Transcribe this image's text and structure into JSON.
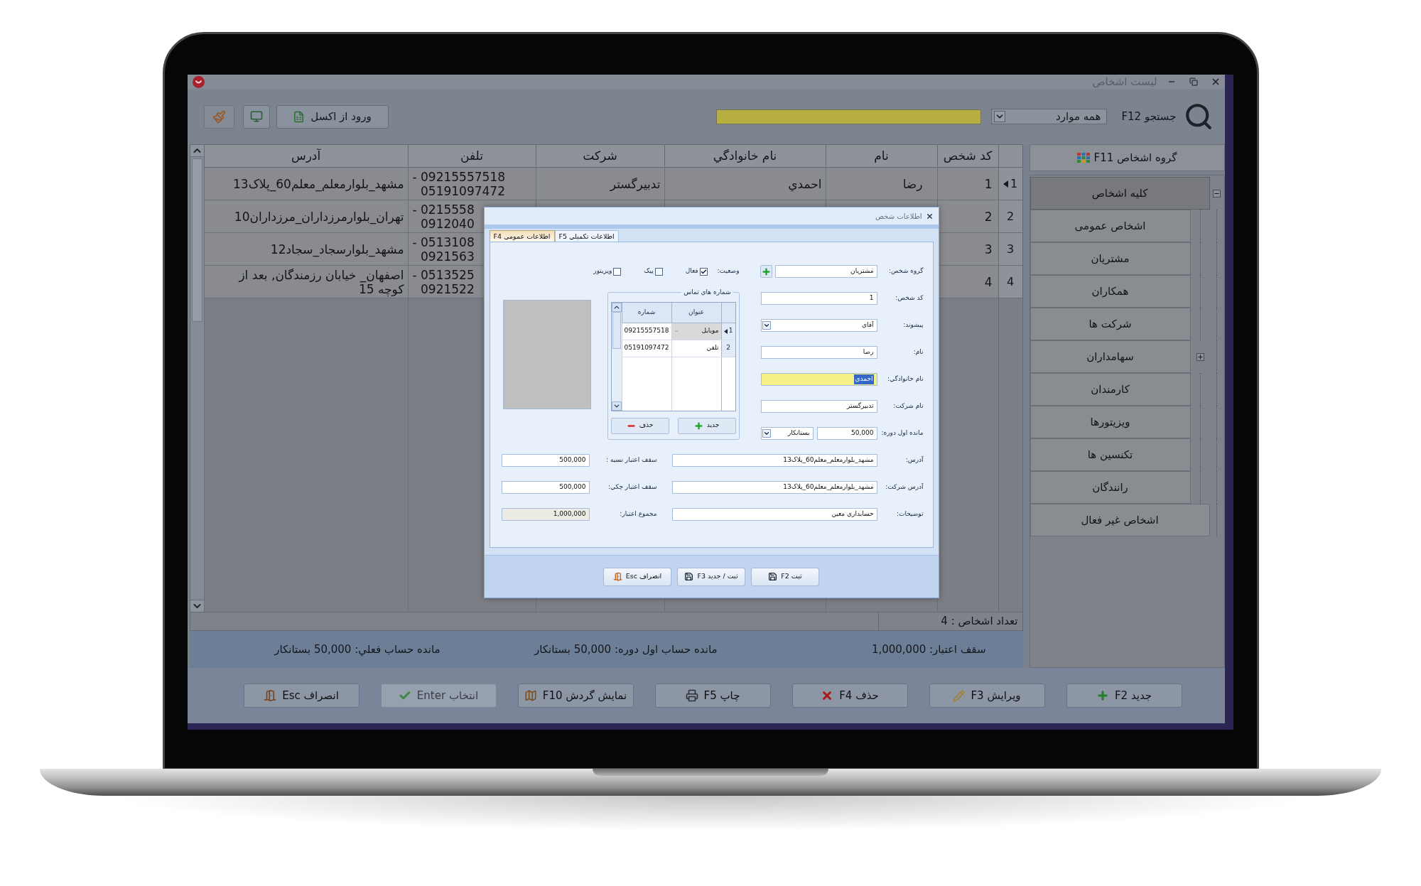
{
  "window": {
    "title": "ليست اشخاص"
  },
  "toolbar": {
    "import_button": "ورود از اکسل",
    "search_label": "جستجو F12",
    "search_scope": "همه موارد"
  },
  "sidebar": {
    "title": "گروه اشخاص F11",
    "items": [
      {
        "label": "کليه اشخاص",
        "selected": true,
        "expanded": true,
        "children": [
          {
            "label": "اشخاص عمومی",
            "selected": false
          },
          {
            "label": "مشتريان",
            "selected": false
          },
          {
            "label": "همکاران",
            "selected": false
          },
          {
            "label": "شرکت ها",
            "selected": false
          },
          {
            "label": "سهامداران",
            "selected": false,
            "expanded": false
          },
          {
            "label": "کارمندان",
            "selected": false
          },
          {
            "label": "ويزيتورها",
            "selected": false
          },
          {
            "label": "تکنسين ها",
            "selected": false
          },
          {
            "label": "رانندگان",
            "selected": false
          }
        ]
      },
      {
        "label": "اشخاص غير فعال",
        "selected": false
      }
    ]
  },
  "table": {
    "columns": [
      "کد شخص",
      "نام",
      "نام خانوادگي",
      "شرکت",
      "تلفن",
      "آدرس"
    ],
    "rows": [
      {
        "index": "1",
        "selected": true,
        "code": "1",
        "first_name": "رضا",
        "last_name": "احمدي",
        "company": "تدبيرگستر",
        "phone": [
          "- 09215557518",
          "05191097472"
        ],
        "address": "مشهد_بلوارمعلم_معلم60_پلاک13"
      },
      {
        "index": "2",
        "selected": false,
        "code": "2",
        "phone": [
          "- 0215558",
          "0912040"
        ],
        "address": "تهران_بلوارمرزداران_مرزداران10"
      },
      {
        "index": "3",
        "selected": false,
        "code": "3",
        "phone": [
          "- 0513108",
          "0921563"
        ],
        "address": "مشهد_بلوارسجاد_سجاد12"
      },
      {
        "index": "4",
        "selected": false,
        "code": "4",
        "phone": [
          "- 0513525",
          "0921522"
        ],
        "address": "اصفهان_ خيابان رزمندگان, بعد از کوچه 15"
      }
    ],
    "footer": "تعداد اشخاص : 4"
  },
  "summary": [
    "سقف اعتبار: 1,000,000",
    "مانده حساب اول دوره: 50,000 بستانکار",
    "مانده حساب فعلي: 50,000 بستانکار"
  ],
  "buttons": [
    {
      "label": "جديد F2",
      "kind": "new",
      "disabled": false
    },
    {
      "label": "ويرايش F3",
      "kind": "edit",
      "disabled": false
    },
    {
      "label": "حذف F4",
      "kind": "delete",
      "disabled": false
    },
    {
      "label": "چاپ F5",
      "kind": "print",
      "disabled": false
    },
    {
      "label": "نمايش گردش F10",
      "kind": "history",
      "disabled": false
    },
    {
      "label": "انتخاب Enter",
      "kind": "select",
      "disabled": true
    },
    {
      "label": "انصراف Esc",
      "kind": "cancel",
      "disabled": false
    }
  ],
  "dialog": {
    "title": "اطلاعات شخص",
    "tabs": [
      {
        "label": "اطلاعات تکميلي F5",
        "selected": false
      },
      {
        "label": "اطلاعات عمومی F4",
        "selected": true
      }
    ],
    "fields": [
      {
        "label": "گروه شخص:",
        "value": "مشتريان",
        "kind": "add",
        "focused": false
      },
      {
        "label": "کد شخص:",
        "value": "1",
        "kind": "text",
        "focused": false
      },
      {
        "label": "پيشوند:",
        "value": "آقاي",
        "kind": "dropdown",
        "focused": false
      },
      {
        "label": "نام:",
        "value": "رضا",
        "kind": "text",
        "focused": false
      },
      {
        "label": "نام خانوادگي:",
        "value": "احمدي",
        "kind": "text",
        "focused": true
      },
      {
        "label": "نام شرکت:",
        "value": "تدبيرگستر",
        "kind": "text",
        "focused": false
      },
      {
        "label": "مانده اول دوره:",
        "value": "50,000",
        "option": "بستانکار",
        "kind": "amount",
        "focused": false
      }
    ],
    "status": {
      "label": "وضعيت:",
      "options": [
        {
          "label": "فعال",
          "checked": true
        },
        {
          "label": "پيک",
          "checked": false
        },
        {
          "label": "ويزيتور",
          "checked": false
        }
      ]
    },
    "contacts": {
      "title": "شماره هاي تماس",
      "columns": [
        "عنوان",
        "شماره"
      ],
      "rows": [
        {
          "index": "1",
          "selected": true,
          "title": "موبايل",
          "number": "09215557518"
        },
        {
          "index": "2",
          "selected": false,
          "title": "تلفن",
          "number": "05191097472"
        }
      ],
      "buttons": [
        {
          "label": "جديد",
          "kind": "add"
        },
        {
          "label": "حذف",
          "kind": "remove"
        }
      ]
    },
    "lower_rows": [
      {
        "field": {
          "label": "آدرس:",
          "value": "مشهد_بلوارمعلم_معلم60_پلاک13"
        },
        "credit": {
          "label": "سقف اعتبار نسيه :",
          "value": "500,000",
          "readonly": false
        }
      },
      {
        "field": {
          "label": "آدرس شرکت:",
          "value": "مشهد_بلوارمعلم_معلم60_پلاک13"
        },
        "credit": {
          "label": "سقف اعتبار چکي:",
          "value": "500,000",
          "readonly": false
        }
      },
      {
        "field": {
          "label": "توضيحات:",
          "value": "حسابداري معين"
        },
        "credit": {
          "label": "مجموع اعتبار:",
          "value": "1,000,000",
          "readonly": true
        }
      }
    ],
    "buttons": [
      {
        "label": "ثبت F2",
        "kind": "save"
      },
      {
        "label": "ثبت / جديد F3",
        "kind": "save_new"
      },
      {
        "label": "انصراف Esc",
        "kind": "cancel"
      }
    ]
  }
}
